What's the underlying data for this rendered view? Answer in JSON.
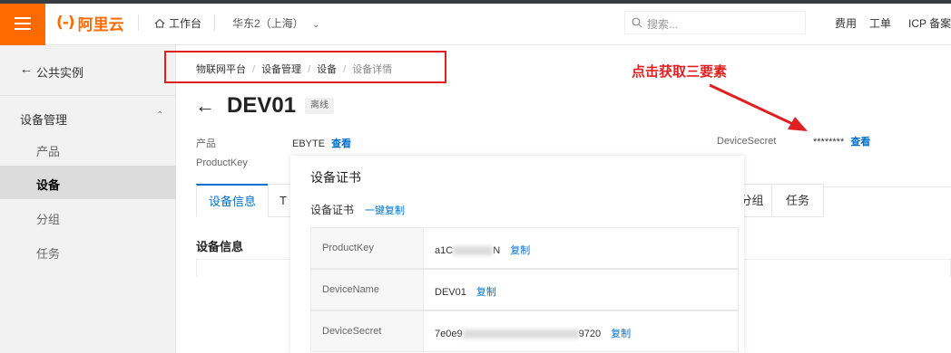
{
  "topbar": {
    "logo_mark": "(-)",
    "logo_text": "阿里云",
    "workbench": "工作台",
    "region": "华东2（上海）",
    "search_placeholder": "搜索...",
    "links": [
      "费用",
      "工单",
      "ICP 备案"
    ]
  },
  "sidebar": {
    "back_label": "公共实例",
    "group_label": "设备管理",
    "items": [
      {
        "label": "产品"
      },
      {
        "label": "设备"
      },
      {
        "label": "分组"
      },
      {
        "label": "任务"
      }
    ]
  },
  "breadcrumb": [
    "物联网平台",
    "设备管理",
    "设备",
    "设备详情"
  ],
  "annotation": "点击获取三要素",
  "device": {
    "name": "DEV01",
    "status": "离线",
    "product_label": "产品",
    "product_value": "EBYTE",
    "view_link": "查看",
    "productkey_label": "ProductKey",
    "secret_label": "DeviceSecret",
    "secret_mask": "********",
    "secret_view": "查看"
  },
  "tabs": {
    "active": "设备信息",
    "partial": "T",
    "group": "分组",
    "task": "任务"
  },
  "section_title": "设备信息",
  "cert": {
    "title": "设备证书",
    "subtitle": "设备证书",
    "copy_all": "一键复制",
    "copy": "复制",
    "rows": [
      {
        "key": "ProductKey",
        "prefix": "a1C",
        "suffix": "N"
      },
      {
        "key": "DeviceName",
        "value": "DEV01"
      },
      {
        "key": "DeviceSecret",
        "prefix": "7e0e9",
        "suffix": "9720"
      }
    ]
  },
  "colors": {
    "brand_orange": "#ff6a00",
    "link_blue": "#0070cc",
    "annotation_red": "#e02020"
  }
}
